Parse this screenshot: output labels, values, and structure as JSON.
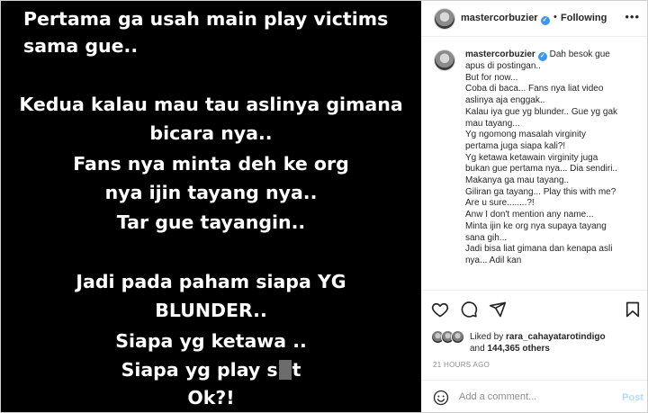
{
  "post_image": {
    "lines": [
      {
        "text": "Pertama ga usah main play victims",
        "first": true
      },
      {
        "text": "sama gue..",
        "first": true
      },
      {
        "text": "Kedua kalau mau tau aslinya gimana"
      },
      {
        "text": "bicara nya.."
      },
      {
        "text": "Fans nya minta deh ke org"
      },
      {
        "text": "nya ijin tayang nya.."
      },
      {
        "text": "Tar gue tayangin.."
      },
      {
        "text": "Jadi pada paham siapa YG"
      },
      {
        "text": "BLUNDER.."
      },
      {
        "text": "Siapa yg ketawa .."
      },
      {
        "text_before": "Siapa yg play s",
        "text_after": "t",
        "censored": true
      },
      {
        "text": "Ok?!"
      }
    ]
  },
  "header": {
    "username": "mastercorbuzier",
    "separator": "•",
    "follow_label": "Following",
    "more_icon": "more-horizontal-icon"
  },
  "caption": {
    "username": "mastercorbuzier",
    "first_line": "Dah besok gue",
    "lines": [
      "apus di postingan..",
      "But for now...",
      "Coba di baca... Fans nya liat video",
      "aslinya aja enggak..",
      "Kalau iya gue yg blunder.. Gue yg gak",
      "mau tayang...",
      "Yg ngomong masalah virginity",
      "pertama juga siapa kali?!",
      "Yg ketawa ketawain virginity juga",
      "bukan gue pertama nya... Dia sendiri..",
      "Makanya ga mau tayang..",
      "Giliran ga tayang... Play this with me?",
      "Are u sure........?!",
      "Anw I don't mention any name...",
      "Minta ijin ke org nya supaya tayang",
      "sana gih...",
      "Jadi bisa liat gimana dan kenapa asli",
      "nya... Adil kan"
    ]
  },
  "actions": {
    "like_icon": "heart-icon",
    "comment_icon": "comment-icon",
    "share_icon": "send-icon",
    "save_icon": "bookmark-icon"
  },
  "likes": {
    "prefix": "Liked by",
    "user": "rara_cahayatarotindigo",
    "and": "and",
    "count": "144,365 others"
  },
  "timestamp": "21 HOURS AGO",
  "comment": {
    "placeholder": "Add a comment...",
    "post_label": "Post"
  },
  "colors": {
    "verified": "#3897f0",
    "post_button_disabled": "#b3dbff",
    "muted_text": "#8e8e8e",
    "image_background": "#000000"
  }
}
